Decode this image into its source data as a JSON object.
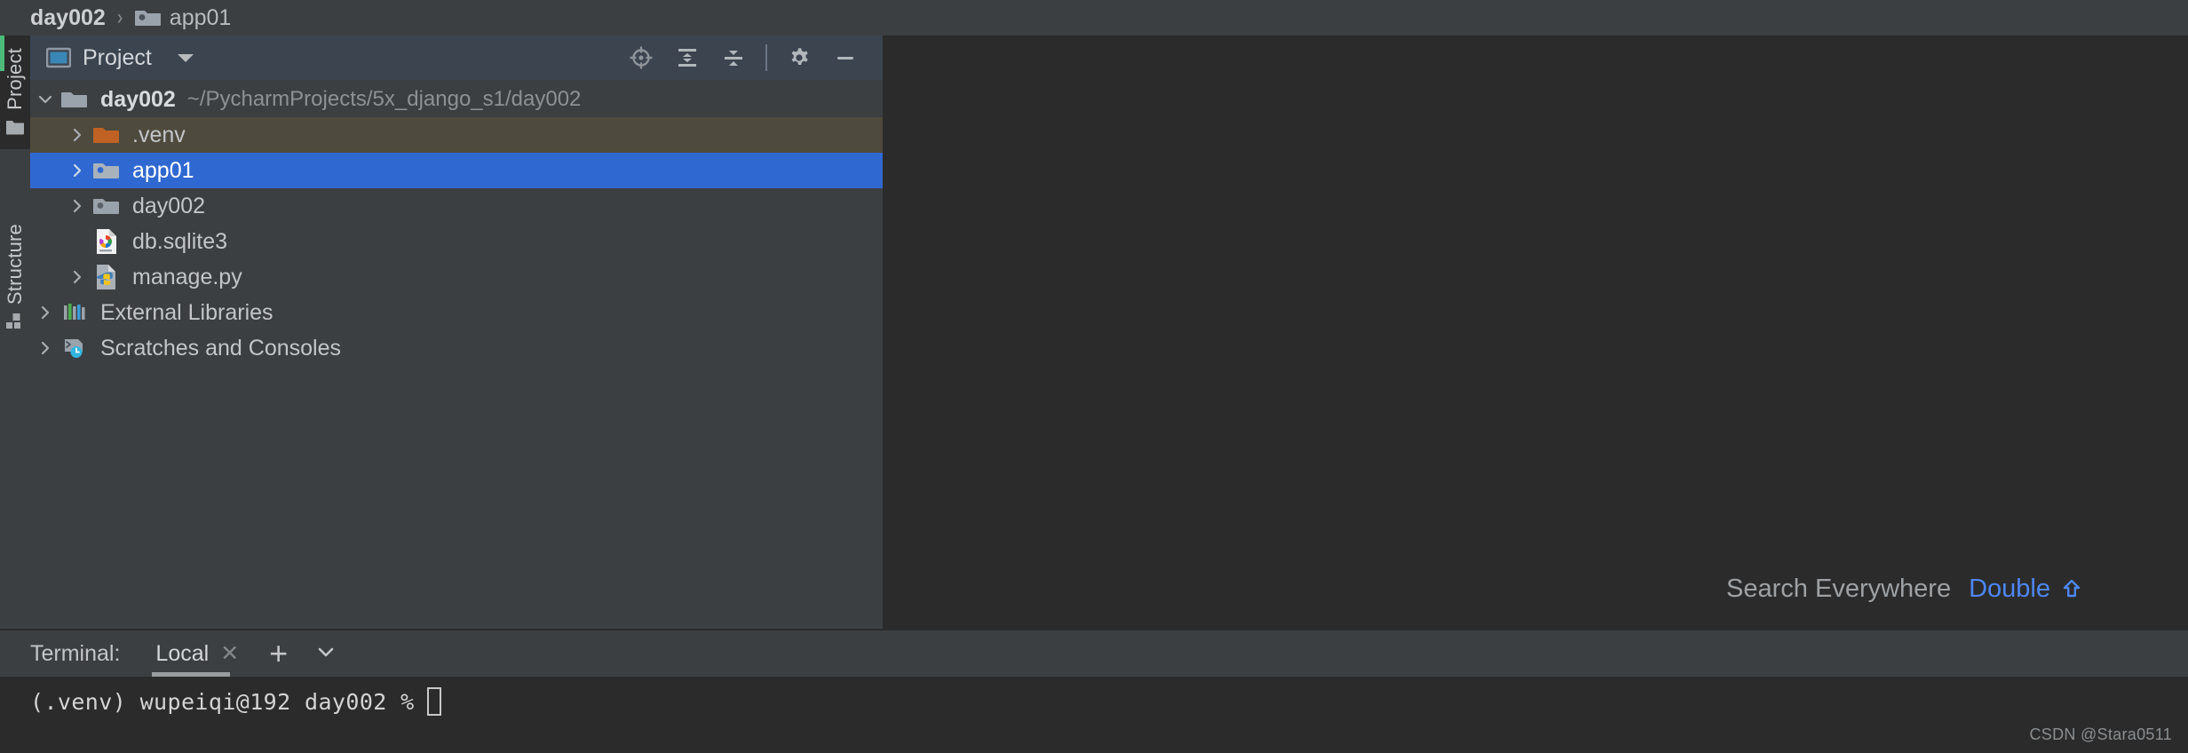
{
  "breadcrumb": {
    "items": [
      {
        "label": "day002",
        "icon": "",
        "bold": true
      },
      {
        "label": "app01",
        "icon": "module-folder-icon",
        "bold": false
      }
    ],
    "separator": "›"
  },
  "rail": {
    "top": {
      "label": "Project",
      "icon": "folder-icon"
    },
    "bottom": {
      "label": "Structure",
      "icon": "structure-icon"
    },
    "accent_color": "#4dbb7a"
  },
  "project_panel": {
    "title": "Project",
    "title_icon": "project-window-icon",
    "dropdown_icon": "chevron-down-icon",
    "tools": [
      {
        "name": "select-opened-file-icon",
        "tooltip": "Select Opened File"
      },
      {
        "name": "expand-all-icon",
        "tooltip": "Expand All"
      },
      {
        "name": "collapse-all-icon",
        "tooltip": "Collapse All"
      },
      {
        "name": "settings-gear-icon",
        "tooltip": "Options"
      },
      {
        "name": "minimize-icon",
        "tooltip": "Hide"
      }
    ],
    "tree": [
      {
        "label": "day002",
        "path": "~/PycharmProjects/5x_django_s1/day002",
        "icon": "project-root-folder-icon",
        "arrow": "expanded",
        "indent": 0,
        "state": "none",
        "bold": true
      },
      {
        "label": ".venv",
        "path": "",
        "icon": "venv-folder-icon",
        "arrow": "collapsed",
        "indent": 1,
        "state": "highlighted",
        "bold": false
      },
      {
        "label": "app01",
        "path": "",
        "icon": "module-folder-icon",
        "arrow": "collapsed",
        "indent": 1,
        "state": "selected",
        "bold": false
      },
      {
        "label": "day002",
        "path": "",
        "icon": "module-folder-icon",
        "arrow": "collapsed",
        "indent": 1,
        "state": "none",
        "bold": false
      },
      {
        "label": "db.sqlite3",
        "path": "",
        "icon": "sqlite-file-icon",
        "arrow": "none",
        "indent": 1,
        "state": "none",
        "bold": false
      },
      {
        "label": "manage.py",
        "path": "",
        "icon": "python-file-icon",
        "arrow": "collapsed",
        "indent": 1,
        "state": "none",
        "bold": false
      },
      {
        "label": "External Libraries",
        "path": "",
        "icon": "external-libraries-icon",
        "arrow": "collapsed",
        "indent": 0,
        "state": "none",
        "bold": false
      },
      {
        "label": "Scratches and Consoles",
        "path": "",
        "icon": "scratches-icon",
        "arrow": "collapsed",
        "indent": 0,
        "state": "none",
        "bold": false
      }
    ]
  },
  "editor": {
    "hint_label": "Search Everywhere",
    "hint_key": "Double",
    "hint_key_icon": "shift-key-icon",
    "hint_key_color": "#4d87f5"
  },
  "terminal": {
    "title": "Terminal:",
    "tab_label": "Local",
    "tab_close_icon": "close-icon",
    "add_icon": "plus-icon",
    "dropdown_icon": "chevron-down-icon",
    "prompt": "(.venv) wupeiqi@192 day002 %"
  },
  "watermark": "CSDN @Stara0511",
  "colors": {
    "selection": "#2f68d0",
    "highlight": "#4e4a3d",
    "panel_bg": "#3c3f41",
    "header_bg": "#3c4450",
    "editor_bg": "#2b2b2b",
    "accent": "#4dbb7a"
  }
}
